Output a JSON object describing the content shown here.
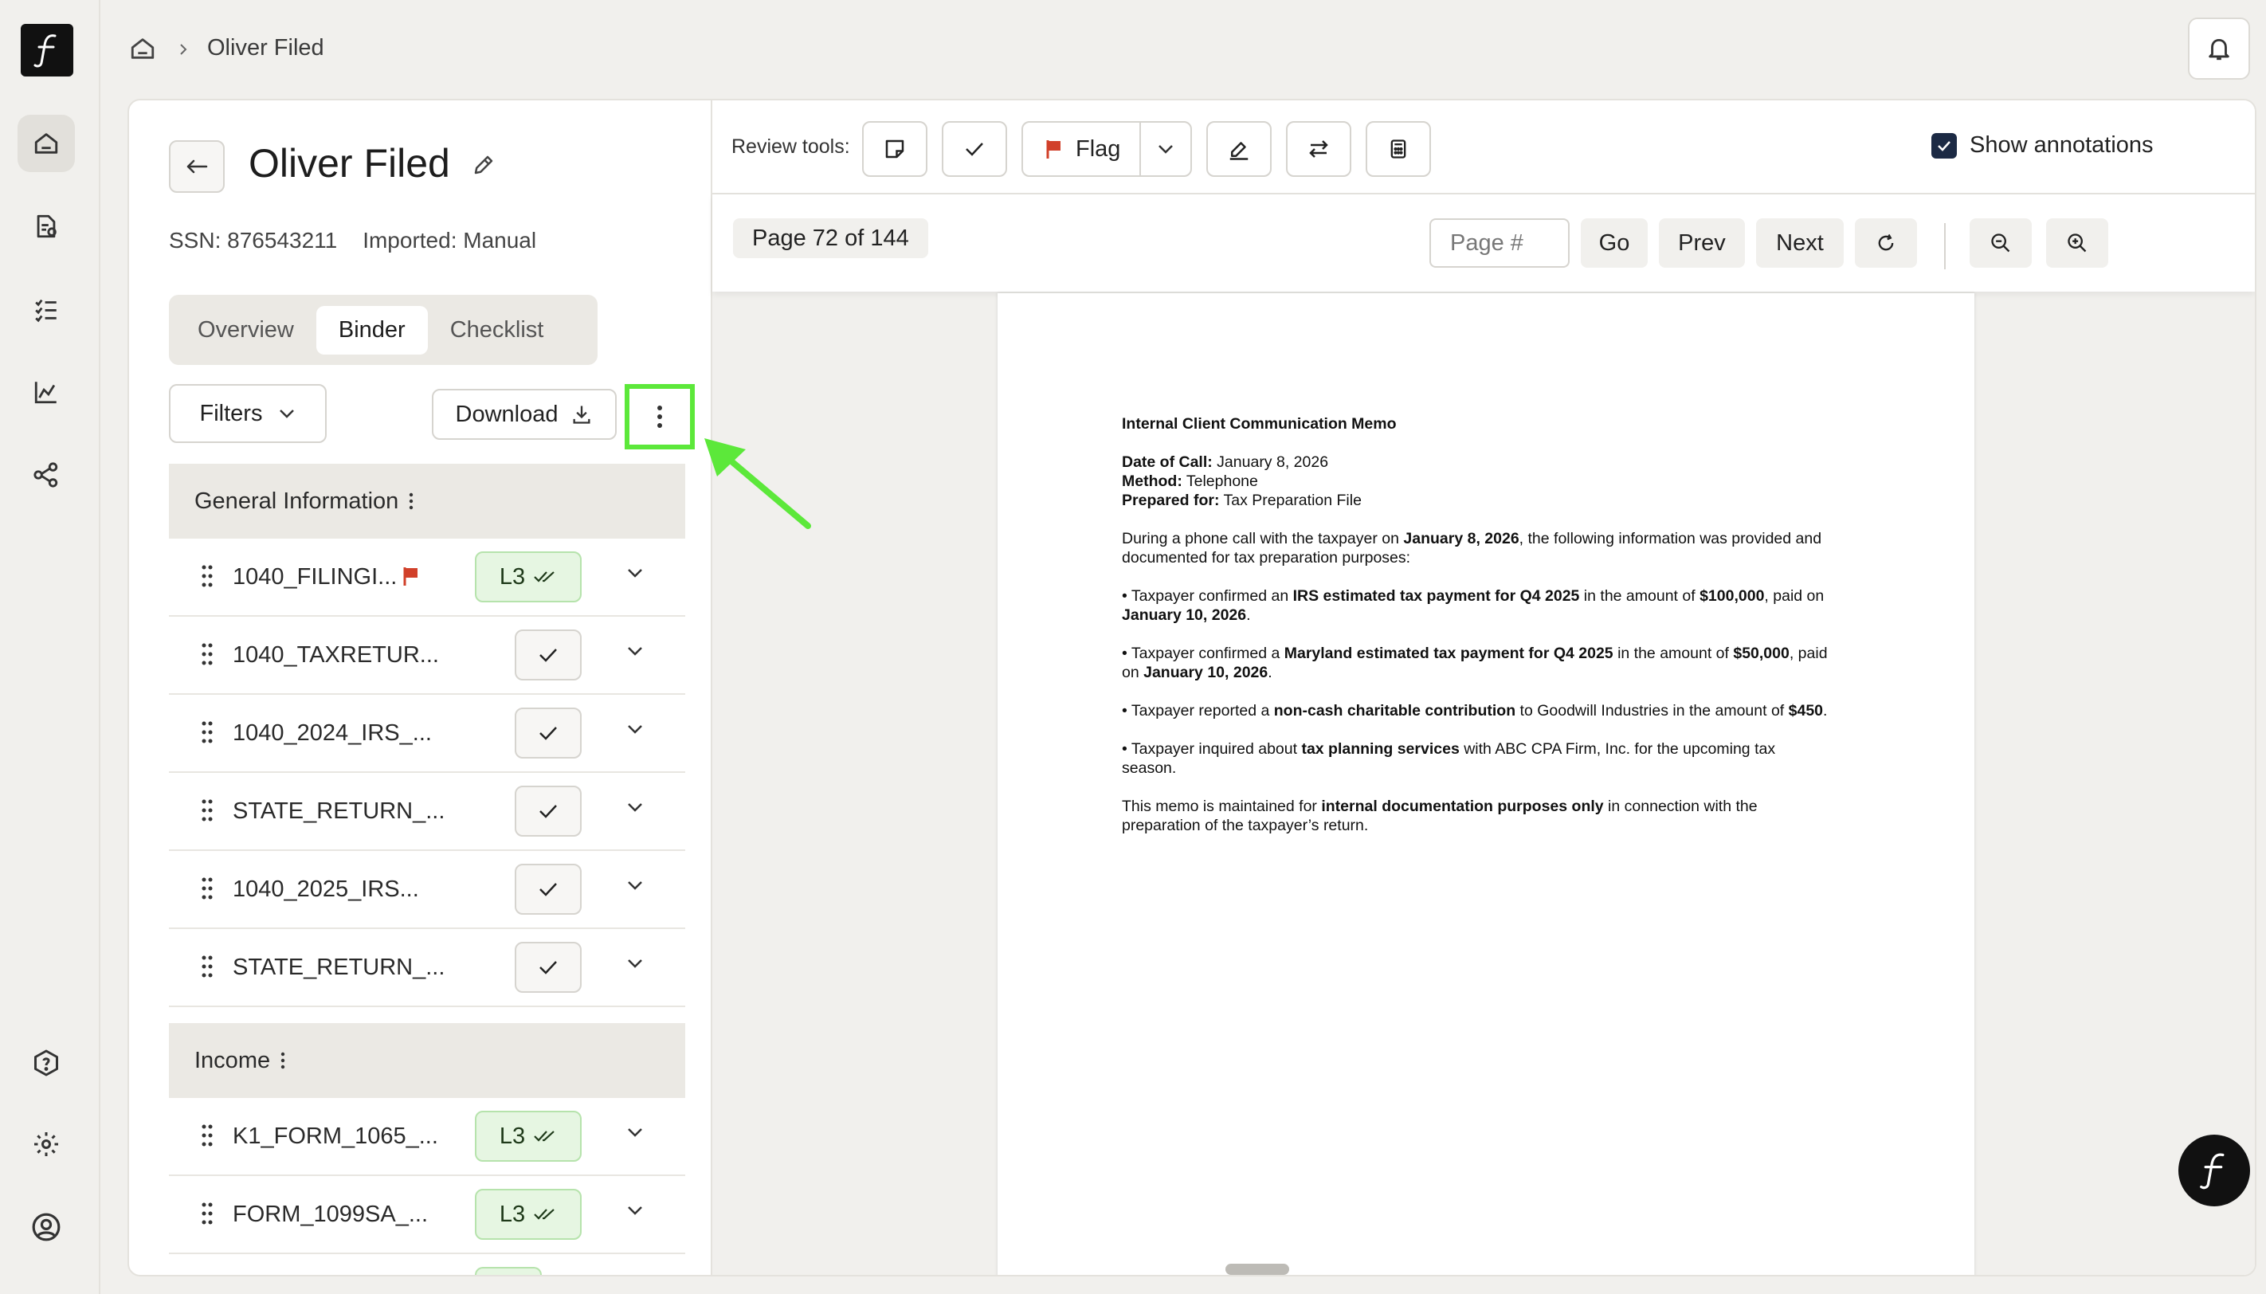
{
  "breadcrumb": {
    "current": "Oliver Filed"
  },
  "client": {
    "name": "Oliver Filed",
    "ssn": "SSN: 876543211",
    "imported": "Imported: Manual"
  },
  "tabs": [
    "Overview",
    "Binder",
    "Checklist"
  ],
  "active_tab": "Binder",
  "toolbar": {
    "filters_label": "Filters",
    "download_label": "Download"
  },
  "sections": [
    {
      "title": "General Information",
      "rows": [
        {
          "name": "1040_FILINGI...",
          "status": "L3",
          "flagged": true
        },
        {
          "name": "1040_TAXRETUR...",
          "status": "check"
        },
        {
          "name": "1040_2024_IRS_...",
          "status": "check"
        },
        {
          "name": "STATE_RETURN_...",
          "status": "check"
        },
        {
          "name": "1040_2025_IRS...",
          "status": "check"
        },
        {
          "name": "STATE_RETURN_...",
          "status": "check"
        }
      ]
    },
    {
      "title": "Income",
      "rows": [
        {
          "name": "K1_FORM_1065_...",
          "status": "L3"
        },
        {
          "name": "FORM_1099SA_...",
          "status": "L3"
        }
      ]
    }
  ],
  "viewer": {
    "review_tools_label": "Review tools:",
    "flag_label": "Flag",
    "show_annotations_label": "Show annotations",
    "show_annotations_checked": true,
    "page_indicator": "Page 72 of 144",
    "page_input_placeholder": "Page #",
    "go_label": "Go",
    "prev_label": "Prev",
    "next_label": "Next"
  },
  "document": {
    "title": "Internal Client Communication Memo",
    "date_label": "Date of Call:",
    "date_value": " January 8, 2026",
    "method_label": "Method:",
    "method_value": " Telephone",
    "prepared_label": "Prepared for:",
    "prepared_value": " Tax Preparation File",
    "intro_a": "During a phone call with the taxpayer on ",
    "intro_b": "January 8, 2026",
    "intro_c": ", the following information was provided and documented for tax preparation purposes:",
    "b1_a": "• Taxpayer confirmed an ",
    "b1_b": "IRS estimated tax payment for Q4 2025",
    "b1_c": " in the amount of ",
    "b1_d": "$100,000",
    "b1_e": ", paid on ",
    "b1_f": "January 10, 2026",
    "b1_g": ".",
    "b2_a": "• Taxpayer confirmed a ",
    "b2_b": "Maryland estimated tax payment for Q4 2025",
    "b2_c": " in the amount of ",
    "b2_d": "$50,000",
    "b2_e": ", paid on ",
    "b2_f": "January 10, 2026",
    "b2_g": ".",
    "b3_a": "• Taxpayer reported a ",
    "b3_b": "non-cash charitable contribution",
    "b3_c": " to Goodwill Industries in the amount of ",
    "b3_d": "$450",
    "b3_e": ".",
    "b4_a": "• Taxpayer inquired about ",
    "b4_b": "tax planning services",
    "b4_c": " with ABC CPA Firm, Inc. for the upcoming tax season.",
    "closing_a": "This memo is maintained for ",
    "closing_b": "internal documentation purposes only",
    "closing_c": " in connection with the preparation of the taxpayer’s return."
  },
  "colors": {
    "highlight": "#5ce83a",
    "flag": "#d1402a",
    "badge_bg": "#e6f6e2",
    "checkbox": "#1c2a44"
  }
}
